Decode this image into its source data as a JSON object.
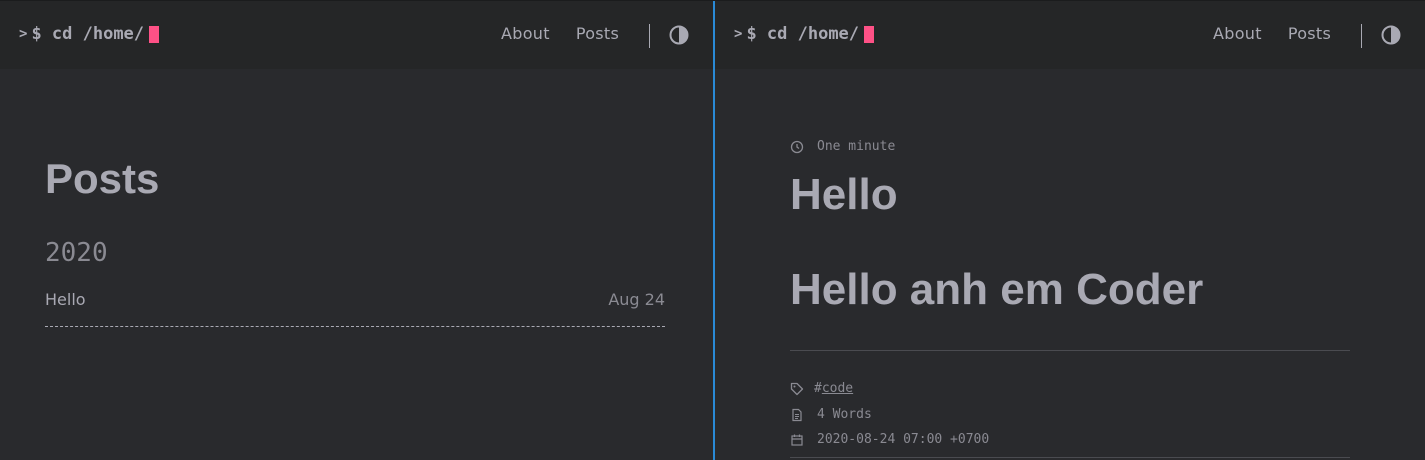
{
  "left": {
    "logo": {
      "prompt": ">",
      "command": "$ cd /home/"
    },
    "nav": {
      "about": "About",
      "posts": "Posts"
    },
    "page_title": "Posts",
    "year": "2020",
    "posts": [
      {
        "title": "Hello",
        "date": "Aug 24"
      }
    ]
  },
  "right": {
    "logo": {
      "prompt": ">",
      "command": "$ cd /home/"
    },
    "nav": {
      "about": "About",
      "posts": "Posts"
    },
    "reading_time": "One minute",
    "title": "Hello",
    "heading": "Hello anh em Coder",
    "tag": {
      "hash": "#",
      "name": "code"
    },
    "word_count": "4 Words",
    "date": "2020-08-24 07:00 +0700"
  },
  "colors": {
    "background": "#292a2d",
    "header": "#252627",
    "text": "#a9a9b3",
    "cursor": "#fe5186",
    "divider": "#2a8ad6"
  },
  "icons": {
    "theme_toggle": "contrast-icon",
    "reading_time": "clock-icon",
    "tag": "tag-icon",
    "word_count": "document-icon",
    "date": "calendar-icon"
  }
}
